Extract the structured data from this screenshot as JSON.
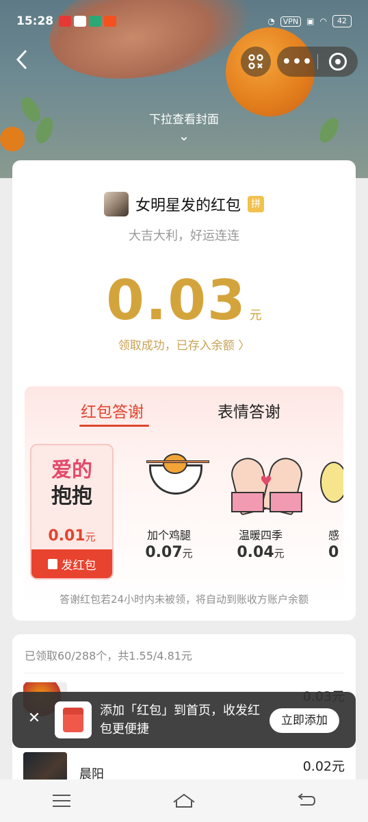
{
  "status_bar": {
    "time": "15:28",
    "vpn": "VPN",
    "battery": "42"
  },
  "header": {
    "pull_hint": "下拉查看封面",
    "pull_arrow": "⌄",
    "back_icon": "back-arrow-icon",
    "scan_icon": "scan-icon",
    "more_icon": "more-dots-icon",
    "close_icon": "target-icon"
  },
  "envelope": {
    "sender_name": "女明星发的红包",
    "pin_badge": "拼",
    "wish": "大吉大利，好运连连",
    "amount": "0.03",
    "unit": "元",
    "stored_text": "领取成功，已存入余额 〉"
  },
  "thanks": {
    "tabs": [
      {
        "label": "红包答谢",
        "active": true
      },
      {
        "label": "表情答谢",
        "active": false
      }
    ],
    "gifts": [
      {
        "art_line1": "爱的",
        "art_line2": "抱抱",
        "price": "0.01",
        "unit": "元",
        "send_label": "发红包",
        "selected": true
      },
      {
        "name": "加个鸡腿",
        "price": "0.07",
        "unit": "元"
      },
      {
        "name": "温暖四季",
        "price": "0.04",
        "unit": "元"
      },
      {
        "name": "感",
        "price": "0",
        "unit": ""
      }
    ],
    "note": "答谢红包若24小时内未被领，将自动到账收方账户余额"
  },
  "records": {
    "summary": "已领取60/288个，共1.55/4.81元",
    "rows": [
      {
        "name": "",
        "amount": "0.03元"
      },
      {
        "name": "晨阳",
        "amount": "0.02元"
      }
    ]
  },
  "toast": {
    "text": "添加「红包」到首页，收发红包更便捷",
    "button": "立即添加",
    "close": "✕"
  },
  "colors": {
    "accent_red": "#e2442f",
    "gold": "#d4a43c"
  }
}
